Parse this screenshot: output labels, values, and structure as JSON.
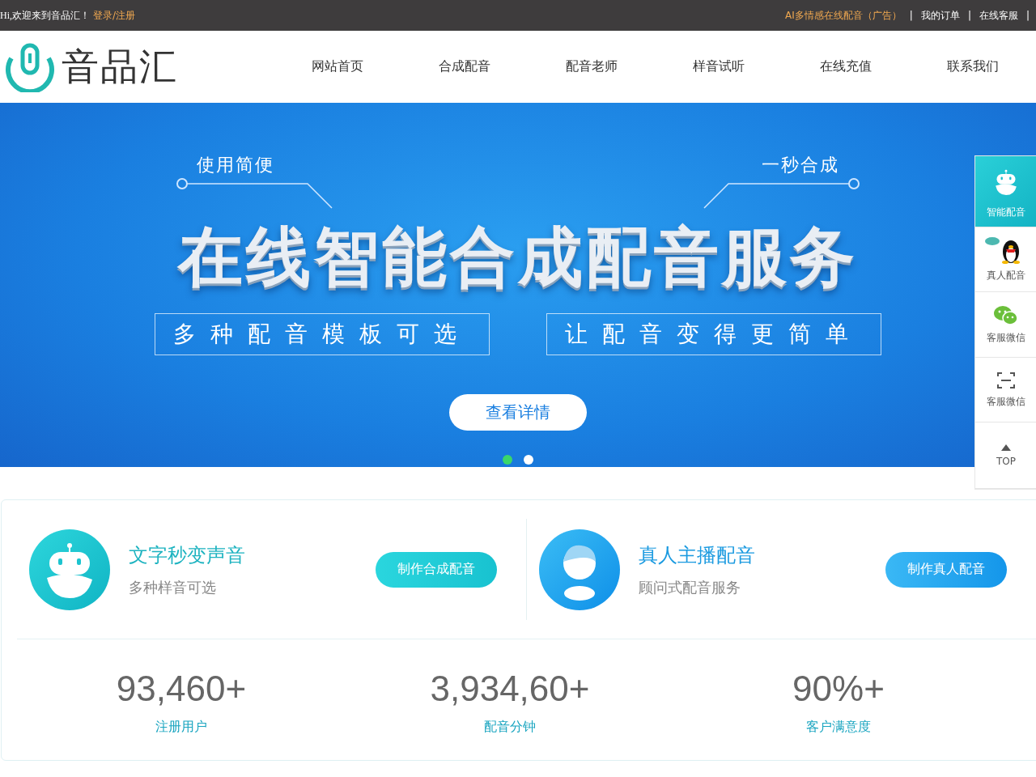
{
  "top_bar": {
    "greeting": "Hi,欢迎来到音品汇！",
    "login_link": "登录/注册",
    "separator": "|",
    "links": [
      {
        "label": "AI多情感在线配音（广告）",
        "kind": "ad"
      },
      {
        "label": "我的订单",
        "kind": "plain"
      },
      {
        "label": "在线客服",
        "kind": "plain"
      }
    ]
  },
  "header": {
    "logo_text": "音品汇",
    "nav": [
      "网站首页",
      "合成配音",
      "配音老师",
      "样音试听",
      "在线充值",
      "联系我们"
    ]
  },
  "banner": {
    "tag_left": "使用简便",
    "tag_right": "一秒合成",
    "headline": "在线智能合成配音服务",
    "subtitles": [
      "多种配音模板可选",
      "让配音变得更简单"
    ],
    "button": "查看详情",
    "dots": [
      {
        "selected": true
      },
      {
        "selected": false
      }
    ]
  },
  "side_toolbar": [
    {
      "label": "智能配音",
      "kind": "robot",
      "selected": true
    },
    {
      "label": "真人配音",
      "kind": "penguin",
      "selected": false
    },
    {
      "label": "客服微信",
      "kind": "wechat",
      "selected": false
    },
    {
      "label": "客服微信",
      "kind": "scan",
      "selected": false
    },
    {
      "label": "TOP",
      "kind": "top",
      "selected": false
    }
  ],
  "services": [
    {
      "title": "文字秒变声音",
      "subtitle": "多种样音可选",
      "button": "制作合成配音",
      "kind": "robot"
    },
    {
      "title": "真人主播配音",
      "subtitle": "顾问式配音服务",
      "button": "制作真人配音",
      "kind": "person"
    }
  ],
  "stats": [
    {
      "value": "93,460+",
      "label": "注册用户"
    },
    {
      "value": "3,934,60+",
      "label": "配音分钟"
    },
    {
      "value": "90%+",
      "label": "客户满意度"
    }
  ]
}
